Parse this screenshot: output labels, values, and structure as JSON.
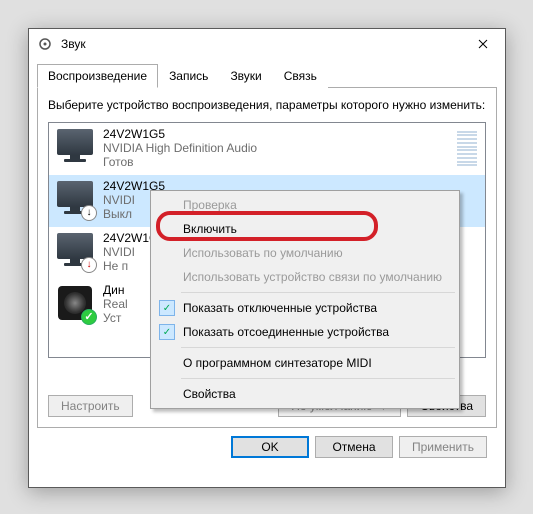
{
  "window": {
    "title": "Звук"
  },
  "tabs": {
    "playback": "Воспроизведение",
    "record": "Запись",
    "sounds": "Звуки",
    "comm": "Связь"
  },
  "instruction": "Выберите устройство воспроизведения, параметры которого нужно изменить:",
  "devices": [
    {
      "name": "24V2W1G5",
      "sub": "NVIDIA High Definition Audio",
      "status": "Готов"
    },
    {
      "name": "24V2W1G5",
      "sub": "NVIDI",
      "status": "Выкл"
    },
    {
      "name": "24V2W1G5",
      "sub": "NVIDI",
      "status": "Не п"
    },
    {
      "name": "Дин",
      "sub": "Real",
      "status": "Уст"
    }
  ],
  "buttons": {
    "configure": "Настроить",
    "default": "По умолчанию",
    "properties": "Свойства",
    "ok": "OK",
    "cancel": "Отмена",
    "apply": "Применить"
  },
  "context_menu": {
    "test": "Проверка",
    "enable": "Включить",
    "set_default": "Использовать по умолчанию",
    "set_comm_default": "Использовать устройство связи по умолчанию",
    "show_disabled": "Показать отключенные устройства",
    "show_disconnected": "Показать отсоединенные устройства",
    "about_midi": "О программном синтезаторе MIDI",
    "props": "Свойства"
  }
}
